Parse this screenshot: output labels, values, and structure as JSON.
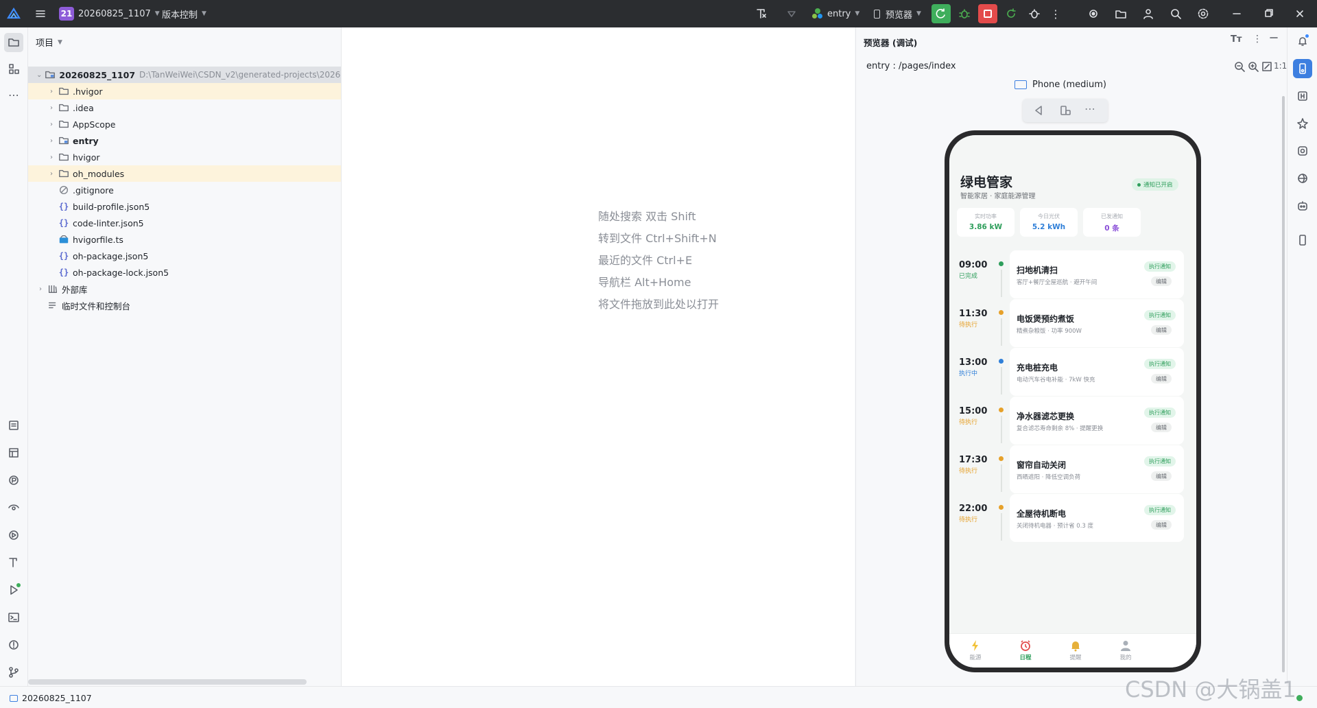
{
  "titlebar": {
    "project_badge": "21",
    "project_name": "20260825_1107",
    "vcs_label": "版本控制",
    "module_label": "entry",
    "run_target_label": "预览器"
  },
  "project_panel": {
    "header": "项目",
    "root_name": "20260825_1107",
    "root_path": "D:\\TanWeiWei\\CSDN_v2\\generated-projects\\2026082",
    "items": [
      {
        "label": ".hvigor",
        "type": "folder"
      },
      {
        "label": ".idea",
        "type": "folder"
      },
      {
        "label": "AppScope",
        "type": "folder"
      },
      {
        "label": "entry",
        "type": "module"
      },
      {
        "label": "hvigor",
        "type": "folder"
      },
      {
        "label": "oh_modules",
        "type": "folder"
      },
      {
        "label": ".gitignore",
        "type": "ignore"
      },
      {
        "label": "build-profile.json5",
        "type": "json"
      },
      {
        "label": "code-linter.json5",
        "type": "json"
      },
      {
        "label": "hvigorfile.ts",
        "type": "ts"
      },
      {
        "label": "oh-package.json5",
        "type": "json"
      },
      {
        "label": "oh-package-lock.json5",
        "type": "json"
      }
    ],
    "external_libs": "外部库",
    "scratches": "临时文件和控制台"
  },
  "editor": {
    "hints": [
      "随处搜索 双击 Shift",
      "转到文件 Ctrl+Shift+N",
      "最近的文件 Ctrl+E",
      "导航栏 Alt+Home",
      "将文件拖放到此处以打开"
    ]
  },
  "previewer": {
    "title": "预览器 (调试)",
    "route": "entry : /pages/index",
    "device": "Phone (medium)",
    "zoom_label": "1:1"
  },
  "app": {
    "title": "绿电管家",
    "subtitle": "智能家居 · 家庭能源管理",
    "badge": "通知已开启",
    "stats": [
      {
        "label": "实时功率",
        "value": "3.86 kW",
        "color": "#2e9e5b"
      },
      {
        "label": "今日光伏",
        "value": "5.2 kWh",
        "color": "#2f7fd8"
      },
      {
        "label": "已发通知",
        "value": "0 条",
        "color": "#8a4fd8"
      }
    ],
    "timeline": [
      {
        "time": "09:00",
        "status": "已完成",
        "status_color": "#2e9e5b",
        "dot": "#2e9e5b",
        "title": "扫地机清扫",
        "desc": "客厅+餐厅全屋巡航 · 避开午间",
        "action": "执行通知",
        "edit": "编辑"
      },
      {
        "time": "11:30",
        "status": "待执行",
        "status_color": "#e6a12a",
        "dot": "#e6a12a",
        "title": "电饭煲预约煮饭",
        "desc": "精煮杂粮饭 · 功率 900W",
        "action": "执行通知",
        "edit": "编辑"
      },
      {
        "time": "13:00",
        "status": "执行中",
        "status_color": "#2f7fd8",
        "dot": "#2f7fd8",
        "title": "充电桩充电",
        "desc": "电动汽车谷电补能 · 7kW 快充",
        "action": "执行通知",
        "edit": "编辑"
      },
      {
        "time": "15:00",
        "status": "待执行",
        "status_color": "#e6a12a",
        "dot": "#e6a12a",
        "title": "净水器滤芯更换",
        "desc": "复合滤芯寿命剩余 8% · 提醒更换",
        "action": "执行通知",
        "edit": "编辑"
      },
      {
        "time": "17:30",
        "status": "待执行",
        "status_color": "#e6a12a",
        "dot": "#e6a12a",
        "title": "窗帘自动关闭",
        "desc": "西晒遮阳 · 降低空调负荷",
        "action": "执行通知",
        "edit": "编辑"
      },
      {
        "time": "22:00",
        "status": "待执行",
        "status_color": "#e6a12a",
        "dot": "#e6a12a",
        "title": "全屋待机断电",
        "desc": "关闭待机电器 · 预计省 0.3 度",
        "action": "执行通知",
        "edit": "编辑"
      }
    ],
    "nav": [
      {
        "label": "能源",
        "icon": "bolt-icon"
      },
      {
        "label": "日程",
        "icon": "alarm-clock-icon",
        "active": true
      },
      {
        "label": "提醒",
        "icon": "bell-icon"
      },
      {
        "label": "我的",
        "icon": "person-icon"
      }
    ]
  },
  "statusbar": {
    "project": "20260825_1107"
  },
  "watermark": "CSDN @大锅盖1"
}
